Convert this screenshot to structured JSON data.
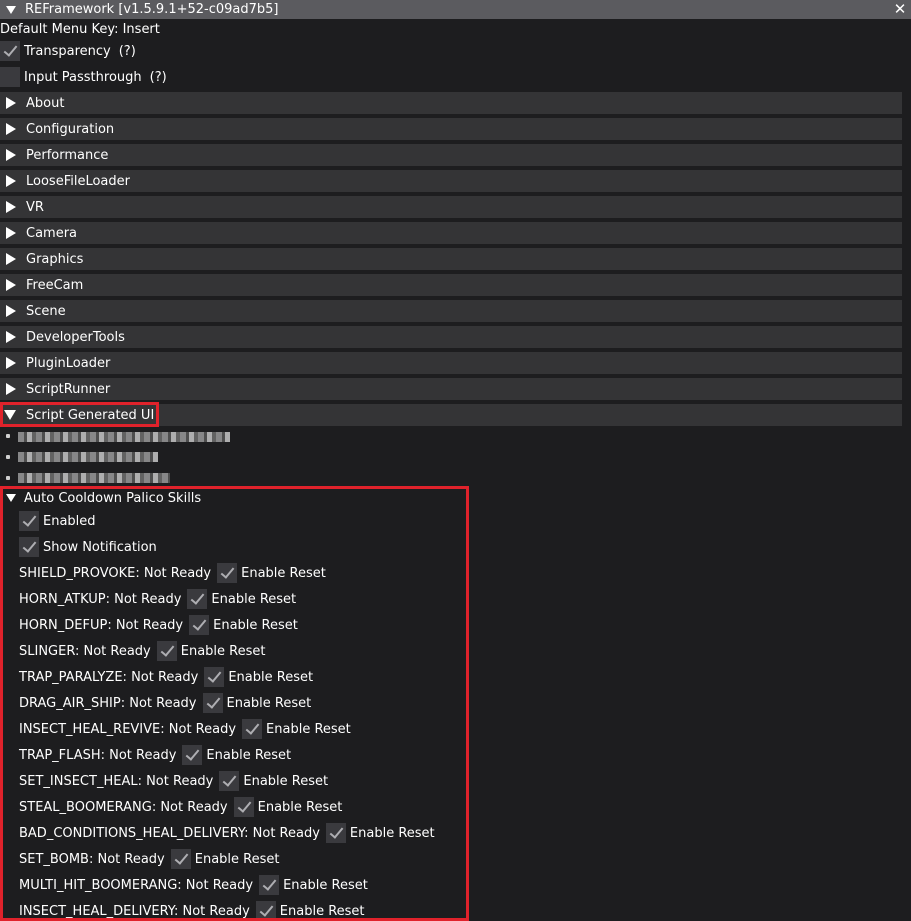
{
  "window": {
    "title": "REFramework [v1.5.9.1+52-c09ad7b5]",
    "close_glyph": "✕"
  },
  "menu_key_text": "Default Menu Key: Insert",
  "options": [
    {
      "label": "Transparency",
      "checked": true,
      "help": "(?)"
    },
    {
      "label": "Input Passthrough",
      "checked": false,
      "help": "(?)"
    }
  ],
  "sections": [
    {
      "label": "About"
    },
    {
      "label": "Configuration"
    },
    {
      "label": "Performance"
    },
    {
      "label": "LooseFileLoader"
    },
    {
      "label": "VR"
    },
    {
      "label": "Camera"
    },
    {
      "label": "Graphics"
    },
    {
      "label": "FreeCam"
    },
    {
      "label": "Scene"
    },
    {
      "label": "DeveloperTools"
    },
    {
      "label": "PluginLoader"
    },
    {
      "label": "ScriptRunner"
    },
    {
      "label": "Script Generated UI",
      "open": true
    }
  ],
  "palico": {
    "header": "Auto Cooldown Palico Skills",
    "enabled_label": "Enabled",
    "show_notification_label": "Show Notification",
    "enable_reset_label": "Enable Reset",
    "skills": [
      {
        "status": "SHIELD_PROVOKE: Not Ready"
      },
      {
        "status": "HORN_ATKUP: Not Ready"
      },
      {
        "status": "HORN_DEFUP: Not Ready"
      },
      {
        "status": "SLINGER: Not Ready"
      },
      {
        "status": "TRAP_PARALYZE: Not Ready"
      },
      {
        "status": "DRAG_AIR_SHIP: Not Ready"
      },
      {
        "status": "INSECT_HEAL_REVIVE: Not Ready"
      },
      {
        "status": "TRAP_FLASH: Not Ready"
      },
      {
        "status": "SET_INSECT_HEAL: Not Ready"
      },
      {
        "status": "STEAL_BOOMERANG: Not Ready"
      },
      {
        "status": "BAD_CONDITIONS_HEAL_DELIVERY: Not Ready"
      },
      {
        "status": "SET_BOMB: Not Ready"
      },
      {
        "status": "MULTI_HIT_BOOMERANG: Not Ready"
      },
      {
        "status": "INSECT_HEAL_DELIVERY: Not Ready"
      }
    ]
  },
  "colors": {
    "highlight": "#e0222b",
    "header_bg": "#343436",
    "title_bg": "#5b5b5f"
  }
}
